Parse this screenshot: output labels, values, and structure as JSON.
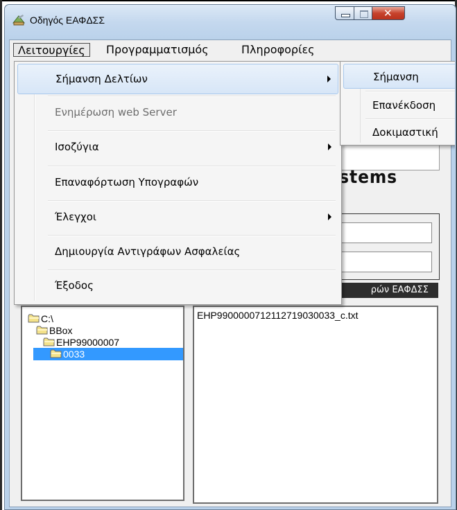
{
  "window": {
    "title": "Οδηγός ΕΑΦΔΣΣ"
  },
  "menubar": {
    "items": [
      {
        "label": "Λειτουργίες"
      },
      {
        "label": "Προγραμματισμός"
      },
      {
        "label": "Πληροφορίες"
      }
    ]
  },
  "dropdown": {
    "items": [
      {
        "label": "Σήμανση Δελτίων",
        "has_submenu": true,
        "highlighted": true
      },
      {
        "label": "Ενημέρωση web Server",
        "disabled": true
      },
      {
        "label": "Ισοζύγια",
        "has_submenu": true
      },
      {
        "label": "Επαναφόρτωση Υπογραφών"
      },
      {
        "label": "Έλεγχοι",
        "has_submenu": true
      },
      {
        "label": "Δημιουργία Αντιγράφων Ασφαλείας"
      },
      {
        "label": "Έξοδος"
      }
    ]
  },
  "submenu": {
    "items": [
      {
        "label": "Σήμανση",
        "highlighted": true
      },
      {
        "label": "Επανέκδοση"
      },
      {
        "label": "Δοκιμαστική"
      }
    ]
  },
  "background": {
    "logo_fragment": "ystems",
    "dark_bar_text": "ρών ΕΑΦΔΣΣ"
  },
  "folder_tree": {
    "nodes": [
      {
        "label": "C:\\"
      },
      {
        "label": "BBox"
      },
      {
        "label": "EHP99000007"
      },
      {
        "label": "0033",
        "selected": true
      }
    ]
  },
  "file_list": {
    "files": [
      "EHP99000007121127190300 33_c.txt"
    ]
  }
}
